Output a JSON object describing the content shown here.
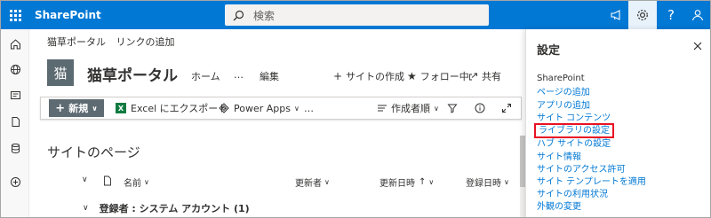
{
  "suite_bar": {
    "app_name": "SharePoint",
    "search_placeholder": "検索"
  },
  "breadcrumb": [
    "猫草ポータル",
    "リンクの追加"
  ],
  "site": {
    "logo_text": "猫",
    "title": "猫草ポータル",
    "nav": [
      "ホーム",
      "…",
      "編集"
    ],
    "actions": {
      "create_site": "サイトの作成",
      "following": "フォロー中",
      "share": "共有"
    }
  },
  "command_bar": {
    "new_label": "新規",
    "export_excel": "Excel にエクスポート",
    "power_apps": "Power Apps",
    "more": "…",
    "view_name": "作成者順"
  },
  "content": {
    "page_heading": "サイトのページ",
    "columns": {
      "name": "名前",
      "modified_by": "更新者",
      "modified": "更新日時",
      "created_by": "登録日時"
    },
    "group_label": "登録者 : システム アカウント (1)"
  },
  "settings_panel": {
    "title": "設定",
    "section": "SharePoint",
    "links": [
      "ページの追加",
      "アプリの追加",
      "サイト コンテンツ",
      "ライブラリの設定",
      "ハブ サイトの設定",
      "サイト情報",
      "サイトのアクセス許可",
      "サイト テンプレートを適用",
      "サイトの利用状況",
      "外観の変更"
    ],
    "highlighted_index": 3
  },
  "colors": {
    "suite_bar": "#0078d4",
    "link": "#0078d4",
    "highlight_border": "#e81123",
    "new_button": "#5f6b73",
    "site_logo": "#5c6a71"
  }
}
